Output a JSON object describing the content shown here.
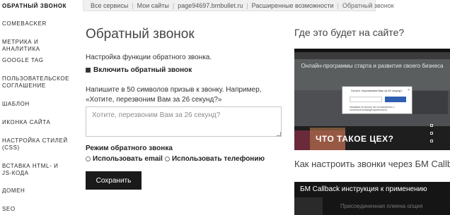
{
  "sidebar": {
    "items": [
      {
        "label": "Обратный звонок"
      },
      {
        "label": "Comebacker"
      },
      {
        "label": "Метрика и аналитика"
      },
      {
        "label": "Google Tag"
      },
      {
        "label": "Пользовательское соглашение"
      },
      {
        "label": "Шаблон"
      },
      {
        "label": "Иконка сайта"
      },
      {
        "label": "Настройка стилей (CSS)"
      },
      {
        "label": "Вставка HTML- и JS-кода"
      },
      {
        "label": "Домен"
      },
      {
        "label": "SEO"
      }
    ]
  },
  "breadcrumb": {
    "items": [
      "Все сервисы",
      "Мои сайты",
      "page94697.bmbullet.ru",
      "Расширенные возможности",
      "Обратный звонок"
    ],
    "separator": "|"
  },
  "main": {
    "title": "Обратный звонок",
    "description": "Настройка функции обратного звонка.",
    "enable_label": "Включить обратный звонок",
    "enable_checked": true,
    "hint": "Напишите в 50 символов призыв к звонку. Например, «Хотите, перезвоним Вам за 26 секунд?»",
    "textarea_placeholder": "Хотите, перезвоним Вам за 26 секунд?",
    "textarea_value": "",
    "mode_label": "Режим обратного звонка",
    "mode_options": [
      {
        "label": "Использовать email",
        "selected": false
      },
      {
        "label": "Использовать телефонию",
        "selected": false
      }
    ],
    "save_label": "Сохранить"
  },
  "right": {
    "where_title": "Где это будет на сайте?",
    "preview": {
      "headline": "Онлайн-программы старта и развития своего бизнеса",
      "card_title": "Хотите, перезвоним Вам за 26 секунд?",
      "card_close": "×",
      "card_footer": "Нажимая на кнопку, вы соглашаетесь с политикой конфиденциальности",
      "big_text": "ЧТО ТАКОЕ ЦЕХ?"
    },
    "how_title": "Как настроить звонки через БМ Callback",
    "video": {
      "title": "БМ Callback инструкция к применению",
      "subtitle": "Присоединенная плеена опция"
    }
  },
  "colors": {
    "button_bg": "#1a1a1a",
    "breadcrumb_bg": "#f0f0f0",
    "card_button": "#2f5fb0"
  }
}
